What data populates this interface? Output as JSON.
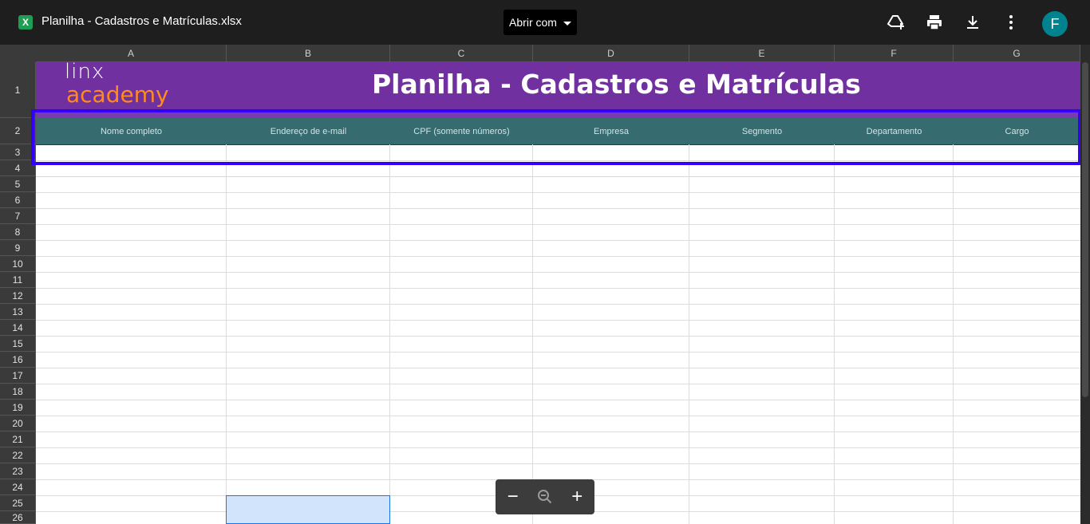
{
  "topbar": {
    "file_icon_letter": "X",
    "file_title": "Planilha - Cadastros e Matrículas.xlsx",
    "open_with_label": "Abrir com",
    "avatar_letter": "F"
  },
  "columns": [
    "A",
    "B",
    "C",
    "D",
    "E",
    "F",
    "G"
  ],
  "rows": [
    "1",
    "2",
    "3",
    "4",
    "5",
    "6",
    "7",
    "8",
    "9",
    "10",
    "11",
    "12",
    "13",
    "14",
    "15",
    "16",
    "17",
    "18",
    "19",
    "20",
    "21",
    "22",
    "23",
    "24",
    "25",
    "26"
  ],
  "sheet": {
    "logo_top": "linx",
    "logo_bottom": "academy",
    "title": "Planilha - Cadastros e Matrículas",
    "headers": [
      "Nome completo",
      "Endereço de e-mail",
      "CPF (somente números)",
      "Empresa",
      "Segmento",
      "Departamento",
      "Cargo"
    ]
  },
  "zoom": {
    "minus": "−",
    "plus": "+"
  },
  "colors": {
    "banner": "#7030a0",
    "header": "#366b70",
    "logo_accent": "#ff8c1a",
    "selection": "#3300ff",
    "avatar": "#00838f"
  }
}
